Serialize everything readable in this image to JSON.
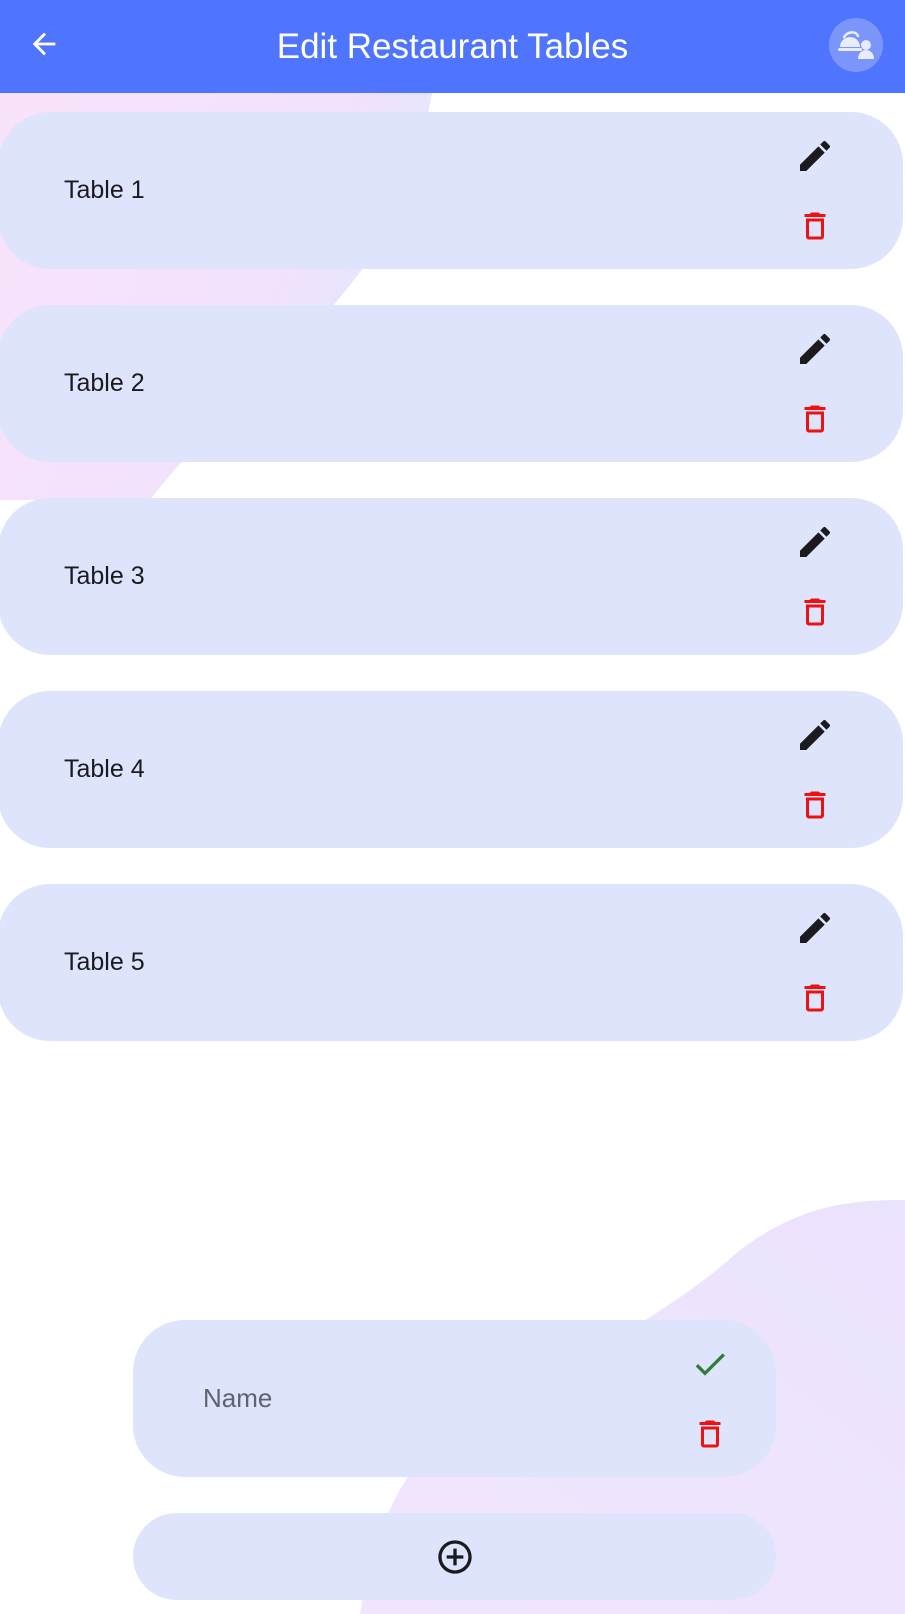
{
  "header": {
    "title": "Edit Restaurant Tables",
    "back_icon": "arrow-back-icon",
    "avatar_icon": "restaurant-staff-avatar-icon",
    "background_color": "#4f74fe"
  },
  "tables": [
    {
      "label": "Table 1"
    },
    {
      "label": "Table 2"
    },
    {
      "label": "Table 3"
    },
    {
      "label": "Table 4"
    },
    {
      "label": "Table 5"
    }
  ],
  "row_icons": {
    "edit": "edit-pencil-icon",
    "delete": "delete-trash-icon"
  },
  "new_table": {
    "placeholder": "Name",
    "value": "",
    "confirm_icon": "check-icon",
    "delete_icon": "delete-trash-icon"
  },
  "add_button": {
    "icon": "add-circle-icon"
  },
  "colors": {
    "card": "#dde4fc",
    "delete": "#ee1111",
    "confirm": "#2e7d32",
    "edit": "#1b1b1f"
  }
}
